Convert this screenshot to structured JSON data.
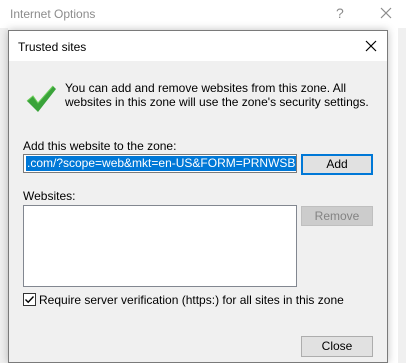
{
  "parent_window": {
    "title": "Internet Options",
    "help_label": "?"
  },
  "dialog": {
    "title": "Trusted sites",
    "info_text": "You can add and remove websites from this zone. All websites in this zone will use the zone's security settings.",
    "add_label": "Add this website to the zone:",
    "url_value": ".com/?scope=web&mkt=en-US&FORM=PRNWSB",
    "add_button": "Add",
    "websites_label": "Websites:",
    "websites": [],
    "remove_button": "Remove",
    "require_checkbox_label": "Require server verification (https:) for all sites in this zone",
    "require_checked": true,
    "close_button": "Close"
  },
  "colors": {
    "accent": "#0078d7",
    "check_green": "#3aa33a"
  }
}
